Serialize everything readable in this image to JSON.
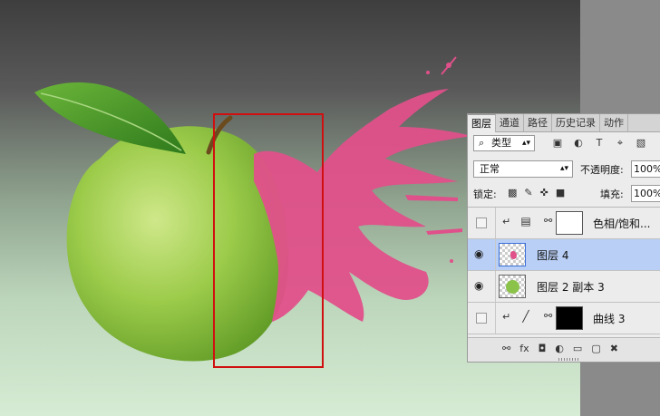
{
  "panel": {
    "tabs": [
      "图层",
      "通道",
      "路径",
      "历史记录",
      "动作"
    ],
    "active_tab": "图层",
    "filter_kind": "类型",
    "blend_mode": "正常",
    "opacity_label": "不透明度:",
    "opacity_value": "100%",
    "lock_label": "锁定:",
    "fill_label": "填充:",
    "fill_value": "100%",
    "layers": [
      {
        "name": "色相/饱和...",
        "visible": false,
        "type": "adjustment",
        "icon": "hue-saturation-icon",
        "mask": "white",
        "clipped": true
      },
      {
        "name": "图层 4",
        "visible": true,
        "type": "pixel",
        "selected": true,
        "thumb": "splash"
      },
      {
        "name": "图层 2 副本 3",
        "visible": true,
        "type": "pixel",
        "thumb": "apple"
      },
      {
        "name": "曲线 3",
        "visible": false,
        "type": "adjustment",
        "icon": "curves-icon",
        "mask": "black",
        "clipped": true
      }
    ]
  },
  "colors": {
    "selection_rect": "#d01010",
    "selected_layer": "#b9cff5",
    "apple": "#8bc34a",
    "paint": "#e0508a"
  }
}
